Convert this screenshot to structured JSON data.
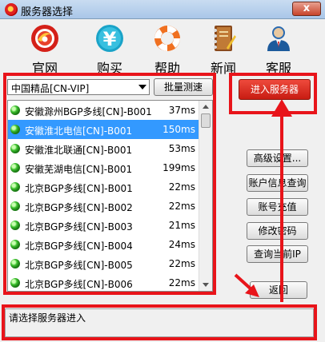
{
  "window": {
    "title": "服务器选择",
    "close_label": "x"
  },
  "toolbar": {
    "items": [
      {
        "label": "官网",
        "icon": "official-site-icon"
      },
      {
        "label": "购买",
        "icon": "yen-icon"
      },
      {
        "label": "帮助",
        "icon": "lifebuoy-icon"
      },
      {
        "label": "新闻",
        "icon": "notebook-icon"
      },
      {
        "label": "客服",
        "icon": "user-icon"
      }
    ]
  },
  "server_group": {
    "selected": "中国精品[CN-VIP]"
  },
  "batch_test_label": "批量测速",
  "enter_server_label": "进入服务器",
  "servers": [
    {
      "name": "安徽滁州BGP多线[CN]-B001",
      "ping": "37ms",
      "selected": false
    },
    {
      "name": "安徽淮北电信[CN]-B001",
      "ping": "150ms",
      "selected": true
    },
    {
      "name": "安徽淮北联通[CN]-B001",
      "ping": "53ms",
      "selected": false
    },
    {
      "name": "安徽芜湖电信[CN]-B001",
      "ping": "199ms",
      "selected": false
    },
    {
      "name": "北京BGP多线[CN]-B001",
      "ping": "22ms",
      "selected": false
    },
    {
      "name": "北京BGP多线[CN]-B002",
      "ping": "22ms",
      "selected": false
    },
    {
      "name": "北京BGP多线[CN]-B003",
      "ping": "21ms",
      "selected": false
    },
    {
      "name": "北京BGP多线[CN]-B004",
      "ping": "24ms",
      "selected": false
    },
    {
      "name": "北京BGP多线[CN]-B005",
      "ping": "22ms",
      "selected": false
    },
    {
      "name": "北京BGP多线[CN]-B006",
      "ping": "22ms",
      "selected": false
    }
  ],
  "side_buttons": {
    "advanced": "高级设置...",
    "account_info": "账户信息查询",
    "recharge": "账号充值",
    "change_password": "修改密码",
    "query_ip": "查询当前IP",
    "back": "返回"
  },
  "status_text": "请选择服务器进入",
  "colors": {
    "highlight_red": "#e8141a",
    "selection_blue": "#3399ff",
    "enter_button_red": "#d9261c"
  }
}
